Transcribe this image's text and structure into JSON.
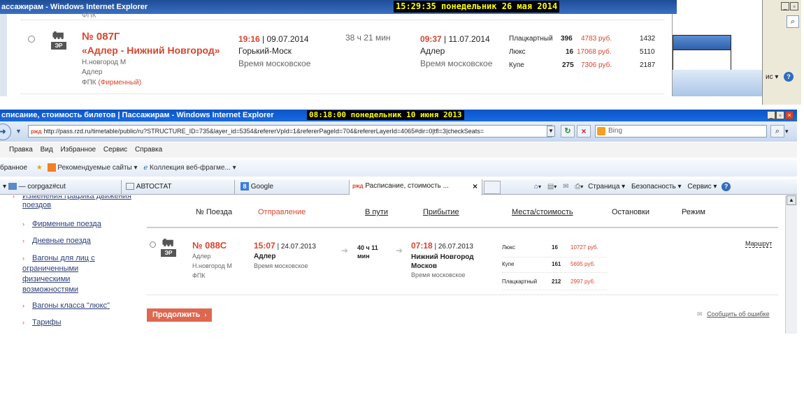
{
  "top_window": {
    "title": "ассажирам - Windows Internet Explorer",
    "clock": "15:29:35  понедельник 26 мая 2014",
    "prev_row_fragment": "ФПК",
    "train": {
      "number": "№ 087Г",
      "route": "«Адлер - Нижний Новгород»",
      "type_label": "ЭР",
      "from_station": "Н.новгород М",
      "to_station": "Адлер",
      "carrier": "ФПК",
      "carrier_note": "(Фирменный)",
      "dep_time": "19:16",
      "dep_date": "| 09.07.2014",
      "dep_station": "Горький-Моск",
      "dep_tz": "Время московское",
      "travel_time": "38 ч 21 мин",
      "arr_time": "09:37",
      "arr_date": "| 11.07.2014",
      "arr_station": "Адлер",
      "arr_tz": "Время московское",
      "seats": [
        {
          "class": "Плацкартный",
          "count": "396",
          "price": "4783 руб.",
          "stops": "1432"
        },
        {
          "class": "Люкс",
          "count": "16",
          "price": "17068 руб.",
          "stops": "5110"
        },
        {
          "class": "Купе",
          "count": "275",
          "price": "7306 руб.",
          "stops": "2187"
        }
      ]
    },
    "right_fragment": "ис ▾"
  },
  "window": {
    "title": "списание, стоимость билетов | Пассажирам - Windows Internet Explorer",
    "clock": "08:18:00  понедельник 10 июня 2013",
    "url": "http://pass.rzd.ru/timetable/public/ru?STRUCTURE_ID=735&layer_id=5354&refererVpId=1&refererPageId=704&refererLayerId=4065#dir=0|tfl=3|checkSeats=",
    "search_placeholder": "Bing",
    "menu": [
      "Правка",
      "Вид",
      "Избранное",
      "Сервис",
      "Справка"
    ],
    "favorites": {
      "label": "бранное",
      "item1": "Рекомендуемые сайты ▾",
      "item2": "Коллекция веб-фрагме... ▾"
    },
    "tabs": [
      "— corpgaz#cut",
      "АВТОСТАТ",
      "Google",
      "Расписание, стоимость ..."
    ],
    "toolbar_items": [
      "Страница ▾",
      "Безопасность ▾",
      "Сервис ▾"
    ]
  },
  "sidebar": {
    "items": [
      "Изменения графика движения поездов",
      "Фирменные поезда",
      "Дневные поезда",
      "Вагоны для лиц с ограниченными физическими возможностями",
      "Вагоны класса \"люкс\"",
      "Тарифы"
    ]
  },
  "table": {
    "headers": {
      "train": "№ Поезда",
      "departure": "Отправление",
      "travel": "В пути",
      "arrival": "Прибытие",
      "seats": "Места/стоимость",
      "stops": "Остановки",
      "mode": "Режим"
    },
    "row": {
      "number": "№ 088С",
      "type_label": "ЭР",
      "from": "Адлер",
      "to": "Н.новгород М",
      "carrier": "ФПК",
      "dep_time": "15:07",
      "dep_date": "| 24.07.2013",
      "dep_station": "Адлер",
      "dep_tz": "Время московское",
      "travel_time": "40 ч 11 мин",
      "arr_time": "07:18",
      "arr_date": "| 26.07.2013",
      "arr_station": "Нижний Новгород Москов",
      "arr_tz": "Время московское",
      "seats": [
        {
          "class": "Люкс",
          "count": "16",
          "price": "10727 руб."
        },
        {
          "class": "Купе",
          "count": "161",
          "price": "5695 руб."
        },
        {
          "class": "Плацкартный",
          "count": "212",
          "price": "2997 руб."
        }
      ],
      "route_link": "Маршрут"
    },
    "continue_button": "Продолжить",
    "report_link": "Сообщить об ошибке"
  }
}
